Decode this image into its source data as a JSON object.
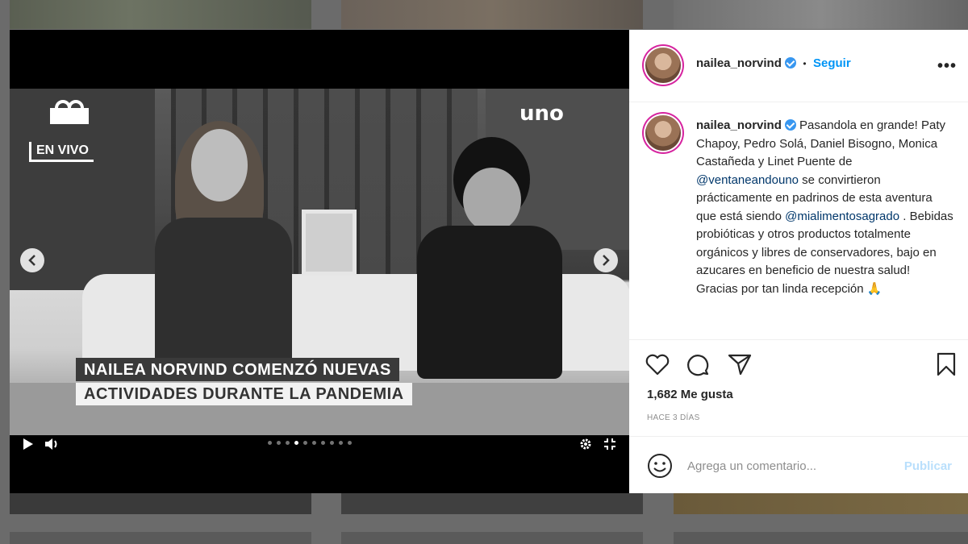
{
  "post": {
    "username": "nailea_norvind",
    "follow_separator": "•",
    "follow_label": "Seguir",
    "more_label": "•••",
    "caption_parts": {
      "p1": "Pasandola en grande! Paty Chapoy, Pedro Solá, Daniel Bisogno, Monica Castañeda y Linet Puente de ",
      "mention1": "@ventaneandouno",
      "p2": " se convirtieron prácticamente en padrinos de esta aventura que está siendo ",
      "mention2": "@mialimentosagrado",
      "p3": " . Bebidas probióticas y otros productos totalmente orgánicos y libres de conservadores, bajo en azucares en beneficio de nuestra salud! Gracias por tan linda recepción 🙏"
    },
    "likes": "1,682 Me gusta",
    "timestamp": "HACE 3 DÍAS",
    "comment_placeholder": "Agrega un comentario...",
    "publish_label": "Publicar"
  },
  "video": {
    "channel_logo": "uno",
    "live_badge": "EN VIVO",
    "headline_line1": "NAILEA NORVIND COMENZÓ NUEVAS",
    "headline_line2": "ACTIVIDADES DURANTE LA PANDEMIA",
    "carousel_dots": 10,
    "active_dot": 4
  },
  "icons": {
    "like": "heart-icon",
    "comment": "comment-icon",
    "share": "paper-plane-icon",
    "save": "bookmark-icon",
    "emoji": "smiley-icon",
    "play": "play-icon",
    "volume": "volume-icon",
    "settings": "gear-icon",
    "fullscreen": "fullscreen-icon"
  }
}
